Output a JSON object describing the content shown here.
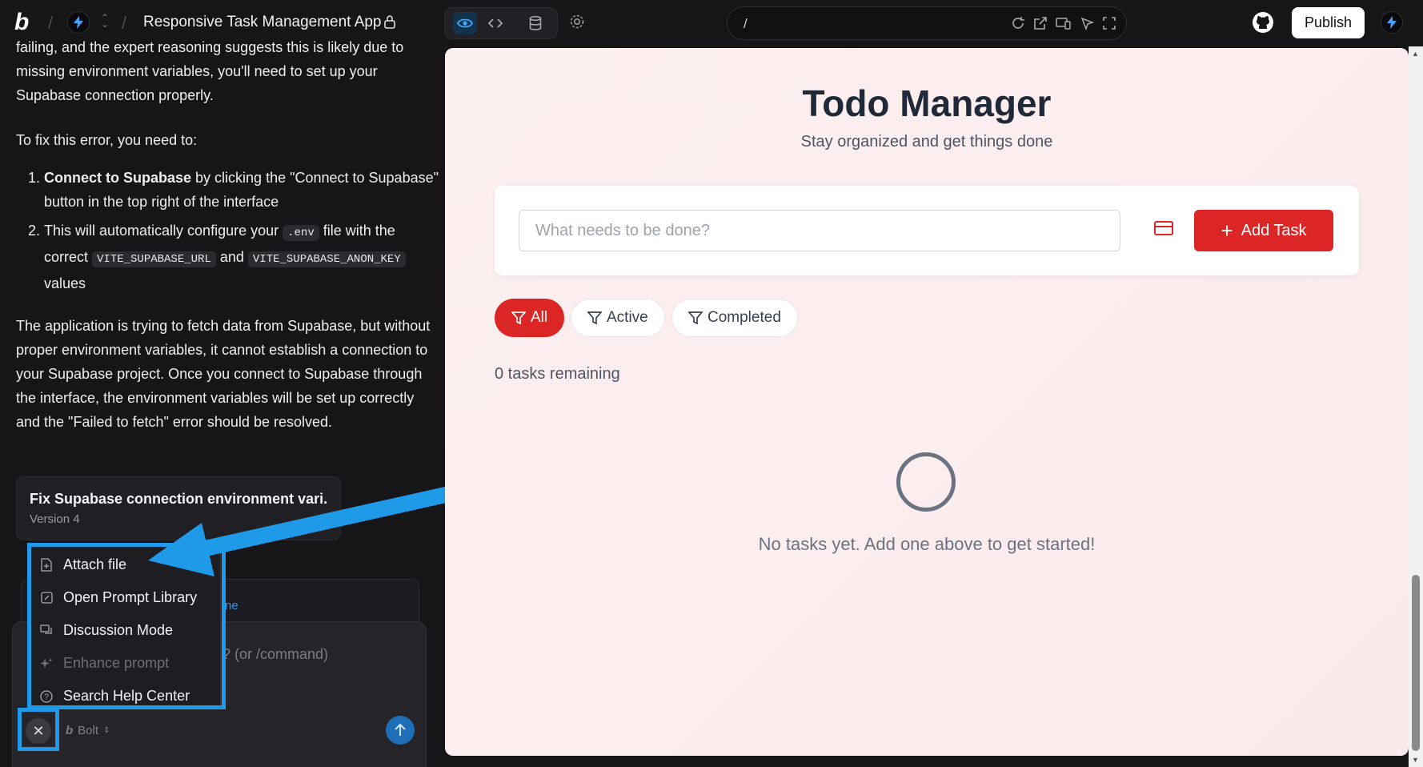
{
  "topbar": {
    "app_title": "Responsive Task Management App",
    "publish_label": "Publish",
    "url_path": "/"
  },
  "chat": {
    "intro": "failing, and the expert reasoning suggests this is likely due to missing environment variables, you'll need to set up your Supabase connection properly.",
    "fix_heading": "To fix this error, you need to:",
    "step1_num": "1.",
    "step1_bold": "Connect to Supabase",
    "step1_rest": " by clicking the \"Connect to Supabase\" button in the top right of the interface",
    "step2_num": "2.",
    "step2_a": "This will automatically configure your ",
    "step2_code1": ".env",
    "step2_b": " file with the correct ",
    "step2_code2": "VITE_SUPABASE_URL",
    "step2_c": " and ",
    "step2_code3": "VITE_SUPABASE_ANON_KEY",
    "step2_d": " values",
    "explanation": "The application is trying to fetch data from Supabase, but without proper environment variables, it cannot establish a connection to your Supabase project. Once you connect to Supabase through the interface, the environment variables will be set up correctly and the \"Failed to fetch\" error should be resolved.",
    "artifact_title": "Fix Supabase connection environment vari...",
    "artifact_version": "Version 4",
    "partial_link": "ne",
    "composer_placeholder": "? (or /command)",
    "model_label": "Bolt"
  },
  "menu": {
    "items": [
      {
        "label": "Attach file",
        "icon": "file-plus-icon",
        "disabled": false
      },
      {
        "label": "Open Prompt Library",
        "icon": "prompt-library-icon",
        "disabled": false
      },
      {
        "label": "Discussion Mode",
        "icon": "chat-bubbles-icon",
        "disabled": false
      },
      {
        "label": "Enhance prompt",
        "icon": "sparkle-icon",
        "disabled": true
      },
      {
        "label": "Search Help Center",
        "icon": "help-circle-icon",
        "disabled": false
      }
    ]
  },
  "preview": {
    "title": "Todo Manager",
    "subtitle": "Stay organized and get things done",
    "input_placeholder": "What needs to be done?",
    "add_label": "Add Task",
    "filters": [
      "All",
      "Active",
      "Completed"
    ],
    "active_filter": "All",
    "remaining": "0 tasks remaining",
    "empty_message": "No tasks yet. Add one above to get started!"
  },
  "colors": {
    "accent_red": "#dc2626",
    "highlight_blue": "#1e9ae8",
    "preview_bg": "#fdf0f0"
  }
}
